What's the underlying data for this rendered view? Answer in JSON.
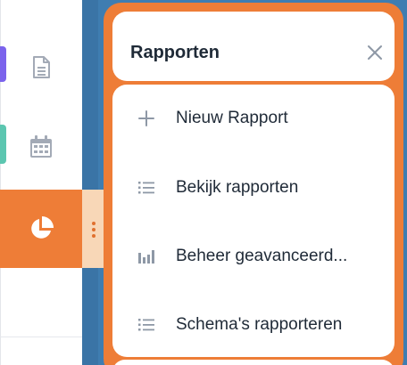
{
  "sidebar": {
    "items": [
      {
        "icon": "document-icon"
      },
      {
        "icon": "calendar-icon"
      },
      {
        "icon": "pie-chart-icon",
        "active": true
      }
    ]
  },
  "popover": {
    "title": "Rapporten",
    "close_icon": "close-icon",
    "items": [
      {
        "label": "Nieuw Rapport",
        "icon": "plus-icon"
      },
      {
        "label": "Bekijk rapporten",
        "icon": "list-icon"
      },
      {
        "label": "Beheer geavanceerd...",
        "icon": "bar-chart-icon"
      },
      {
        "label": "Schema's rapporteren",
        "icon": "list-icon"
      }
    ]
  },
  "colors": {
    "accent_orange": "#ee7d37",
    "accent_purple": "#7b63ec",
    "accent_teal": "#5cc6b0",
    "main_blue": "#3f7db1",
    "text_dark": "#1f2a37",
    "icon_gray": "#9aa3b2"
  }
}
